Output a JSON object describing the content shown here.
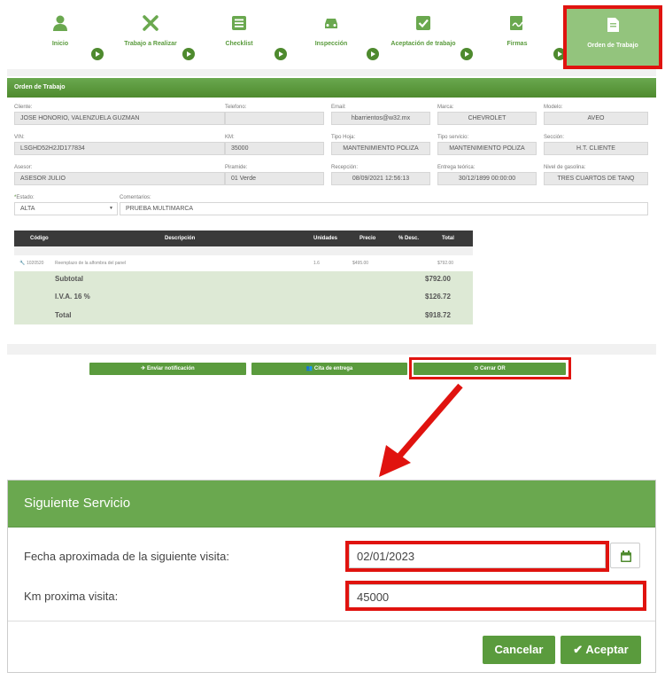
{
  "stepper": {
    "steps": [
      {
        "label": "Inicio",
        "icon": "user-icon"
      },
      {
        "label": "Trabajo a Realizar",
        "icon": "tools-icon"
      },
      {
        "label": "Checklist",
        "icon": "checklist-icon"
      },
      {
        "label": "Inspección",
        "icon": "car-icon"
      },
      {
        "label": "Aceptación de trabajo",
        "icon": "checkbox-icon"
      },
      {
        "label": "Firmas",
        "icon": "signature-icon"
      },
      {
        "label": "Orden de Trabajo",
        "icon": "document-icon"
      }
    ]
  },
  "order": {
    "title": "Orden de Trabajo",
    "fields": {
      "cliente": {
        "label": "Cliente:",
        "value": "JOSE HONORIO, VALENZUELA GUZMAN"
      },
      "telefono": {
        "label": "Telefono:",
        "value": ""
      },
      "email": {
        "label": "Email:",
        "value": "hbarrientos@w32.mx"
      },
      "marca": {
        "label": "Marca:",
        "value": "CHEVROLET"
      },
      "modelo": {
        "label": "Modelo:",
        "value": "AVEO"
      },
      "vin": {
        "label": "VIN:",
        "value": "LSGHD52H2JD177834"
      },
      "km": {
        "label": "KM:",
        "value": "35000"
      },
      "tipo_hoja": {
        "label": "Tipo Hoja:",
        "value": "MANTENIMIENTO POLIZA"
      },
      "tipo_servicio": {
        "label": "Tipo servicio:",
        "value": "MANTENIMIENTO POLIZA"
      },
      "seccion": {
        "label": "Sección:",
        "value": "H.T. CLIENTE"
      },
      "asesor": {
        "label": "Asesor:",
        "value": "ASESOR JULIO"
      },
      "piramide": {
        "label": "Piramide:",
        "value": "01 Verde"
      },
      "recepcion": {
        "label": "Recepción:",
        "value": "08/09/2021 12:56:13"
      },
      "entrega": {
        "label": "Entrega teórica:",
        "value": "30/12/1899 00:00:00"
      },
      "gasolina": {
        "label": "Nivel de gasolina:",
        "value": "TRES CUARTOS DE TANQ"
      },
      "estado": {
        "label": "Estado:",
        "value": "ALTA",
        "required_mark": "*"
      },
      "comentarios": {
        "label": "Comentarios:",
        "value": "PRUEBA MULTIMARCA"
      }
    },
    "table": {
      "headers": {
        "codigo": "Código",
        "descripcion": "Descripción",
        "unidades": "Unidades",
        "precio": "Precio",
        "desc": "% Desc.",
        "total": "Total"
      },
      "rows": [
        {
          "codigo": "1020520",
          "descripcion": "Reemplazo de la alfombra del panel",
          "unidades": "1.6",
          "precio": "$495.00",
          "desc": "",
          "total": "$792.00"
        }
      ],
      "subtotal_label": "Subtotal",
      "subtotal": "$792.00",
      "iva_label": "I.V.A. 16 %",
      "iva": "$126.72",
      "total_label": "Total",
      "total": "$918.72"
    },
    "buttons": {
      "enviar": "Enviar notificación",
      "cita": "Cita de entrega",
      "cerrar": "Cerrar OR"
    }
  },
  "dialog": {
    "title": "Siguiente Servicio",
    "fecha_label": "Fecha aproximada de la siguiente visita:",
    "fecha_value": "02/01/2023",
    "km_label": "Km proxima visita:",
    "km_value": "45000",
    "cancel_label": "Cancelar",
    "accept_label": "Aceptar"
  },
  "colors": {
    "brand_green": "#6aa84f",
    "highlight_red": "#e0130f"
  }
}
